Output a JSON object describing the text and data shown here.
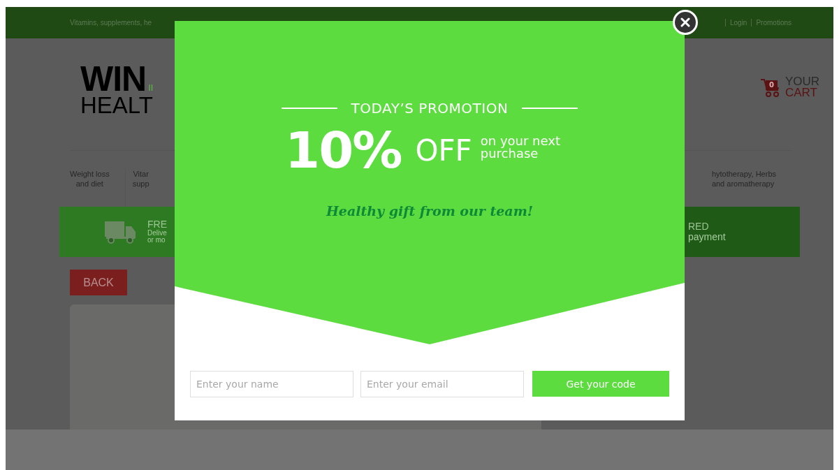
{
  "top_bar": {
    "tagline": "Vitamins, supplements, he",
    "links": [
      {
        "label": "Login"
      },
      {
        "label": "Promotions"
      }
    ]
  },
  "logo": {
    "line1": "WIN",
    "mark": "II",
    "line2": "HEALT"
  },
  "cart": {
    "count": "0",
    "line1": "YOUR",
    "line2": "CART"
  },
  "categories_left": [
    {
      "lines": [
        "Weight loss",
        "and diet"
      ]
    },
    {
      "lines": [
        "Vitar",
        "supp"
      ]
    }
  ],
  "categories_right": [
    {
      "lines": [
        "hytotherapy, Herbs",
        "and aromatherapy"
      ]
    }
  ],
  "banners": [
    {
      "title": "FRE",
      "lines": [
        "Delive",
        "or mo"
      ]
    },
    {
      "title": "RED",
      "lines": [
        "payment"
      ]
    }
  ],
  "back_button": "BACK",
  "popup": {
    "heading": "TODAY’S PROMOTION",
    "discount": "10%",
    "off": "OFF",
    "offer_note": [
      "on your next",
      "purchase"
    ],
    "gift_line": "Healthy gift from our team!",
    "name_field": {
      "placeholder": "Enter your name"
    },
    "email_field": {
      "placeholder": "Enter your email"
    },
    "submit": "Get your code"
  }
}
